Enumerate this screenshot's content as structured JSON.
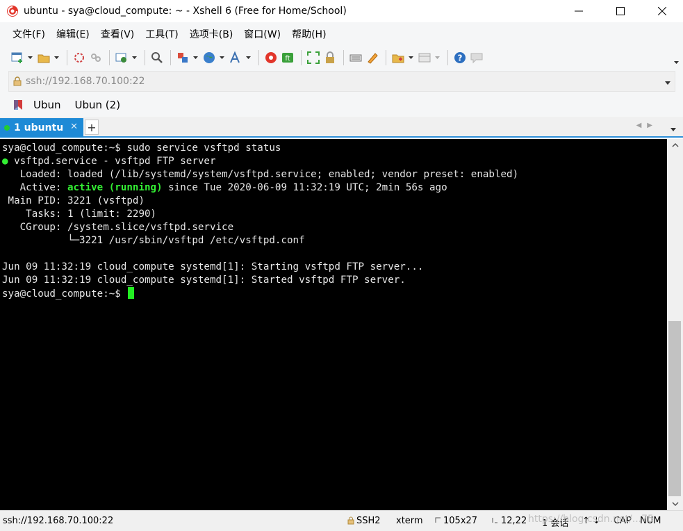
{
  "window": {
    "title": "ubuntu - sya@cloud_compute: ~ - Xshell 6 (Free for Home/School)"
  },
  "menu": {
    "items": [
      "文件(F)",
      "编辑(E)",
      "查看(V)",
      "工具(T)",
      "选项卡(B)",
      "窗口(W)",
      "帮助(H)"
    ]
  },
  "toolbar": {
    "icons": [
      "new-session-icon",
      "open-folder-icon",
      "reconnect-icon",
      "disconnect-icon",
      "properties-icon",
      "find-icon",
      "transfer-icon",
      "globe-icon",
      "font-icon",
      "xshell-icon",
      "xftp-icon",
      "fullscreen-icon",
      "lock-icon",
      "keyboard-icon",
      "highlight-icon",
      "compose-icon",
      "layout-icon",
      "help-icon",
      "chat-icon"
    ]
  },
  "address": {
    "value": "ssh://192.168.70.100:22"
  },
  "links": {
    "items": [
      "Ubun",
      "Ubun (2)"
    ]
  },
  "tabs": {
    "active_label": "1 ubuntu",
    "close": "✕",
    "add": "+"
  },
  "terminal": {
    "lines": {
      "l0": "sya@cloud_compute:~$ sudo service vsftpd status",
      "l1_bullet": "●",
      "l1_rest": " vsftpd.service - vsftpd FTP server",
      "l2": "   Loaded: loaded (/lib/systemd/system/vsftpd.service; enabled; vendor preset: enabled)",
      "l3_pre": "   Active: ",
      "l3_status": "active (running)",
      "l3_post": " since Tue 2020-06-09 11:32:19 UTC; 2min 56s ago",
      "l4": " Main PID: 3221 (vsftpd)",
      "l5": "    Tasks: 1 (limit: 2290)",
      "l6": "   CGroup: /system.slice/vsftpd.service",
      "l7": "           └─3221 /usr/sbin/vsftpd /etc/vsftpd.conf",
      "l8": "",
      "l9": "Jun 09 11:32:19 cloud_compute systemd[1]: Starting vsftpd FTP server...",
      "l10": "Jun 09 11:32:19 cloud_compute systemd[1]: Started vsftpd FTP server.",
      "l11": "sya@cloud_compute:~$ "
    }
  },
  "status": {
    "address": "ssh://192.168.70.100:22",
    "protocol": "SSH2",
    "term": "xterm",
    "size": "105x27",
    "cursor": "12,22",
    "sessions": "1 会话",
    "caps": "CAP",
    "num": "NUM",
    "watermark": "https://blog.csdn.net/...75"
  },
  "colors": {
    "tab_active": "#1e8ad6",
    "terminal_bg": "#000000",
    "terminal_green": "#33ee33"
  }
}
